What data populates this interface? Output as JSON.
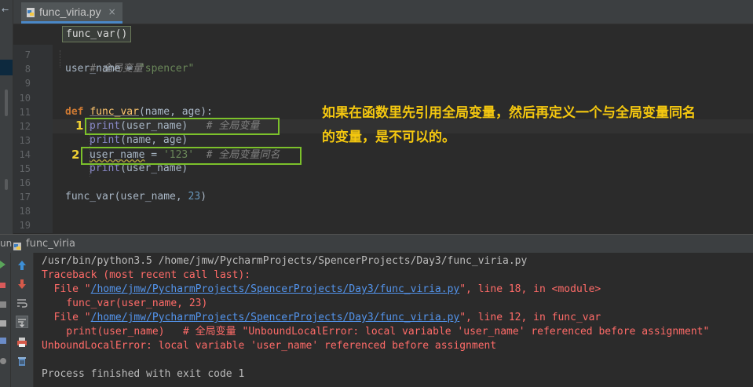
{
  "editor": {
    "tab_label": "func_viria.py",
    "tab_close": "×",
    "breadcrumb": "func_var()",
    "line_numbers": [
      "7",
      "8",
      "9",
      "10",
      "11",
      "12",
      "13",
      "14",
      "15",
      "16",
      "17",
      "18",
      "19"
    ],
    "lines": {
      "l7_comment": "# 全局变量",
      "l8_var": "user_name",
      "l8_eq": " = ",
      "l8_str": "\"spencer\"",
      "l11_def": "def",
      "l11_name": "func_var",
      "l11_params": "(name, age):",
      "l12_print": "print",
      "l12_args": "(user_name)",
      "l12_comment": "# 全局变量",
      "l13_print": "print",
      "l13_args": "(name, age)",
      "l14_var": "user_name",
      "l14_eq": " = ",
      "l14_str": "'123'",
      "l14_comment": "# 全局变量同名",
      "l15_print": "print",
      "l15_args": "(user_name)",
      "l17_call": "func_var(user_name, ",
      "l17_num": "23",
      "l17_close": ")"
    },
    "box_labels": [
      "1",
      "2"
    ]
  },
  "annotation": {
    "line1": "如果在函数里先引用全局变量，然后再定义一个与全局变量同名",
    "line2": "的变量，是不可以的。"
  },
  "run_panel": {
    "edge_label": "un",
    "title": "func_viria",
    "console": {
      "cmd": "/usr/bin/python3.5 /home/jmw/PycharmProjects/SpencerProjects/Day3/func_viria.py",
      "traceback": "Traceback (most recent call last):",
      "file1_prefix": "  File \"",
      "file1_link": "/home/jmw/PycharmProjects/SpencerProjects/Day3/func_viria.py",
      "file1_suffix": "\", line 18, in <module>",
      "src1": "    func_var(user_name, 23)",
      "file2_prefix": "  File \"",
      "file2_link": "/home/jmw/PycharmProjects/SpencerProjects/Day3/func_viria.py",
      "file2_suffix": "\", line 12, in func_var",
      "src2": "    print(user_name)   # 全局变量 \"UnboundLocalError: local variable 'user_name' referenced before assignment\"",
      "error": "UnboundLocalError: local variable 'user_name' referenced before assignment",
      "finished": "Process finished with exit code 1"
    }
  },
  "colors": {
    "box_green": "#7cc12b",
    "annotation_yellow": "#f5c80f",
    "error_red": "#ff6b68",
    "link_blue": "#5394ec"
  }
}
